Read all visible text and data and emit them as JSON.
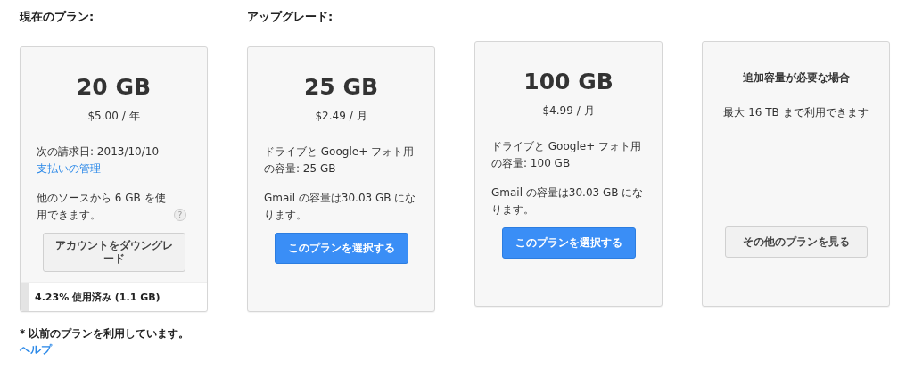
{
  "current": {
    "heading": "現在のプラン:",
    "card": {
      "size": "20 GB",
      "price": "$5.00 / 年",
      "billing": "次の請求日: 2013/10/10",
      "manage_link": "支払いの管理",
      "other_sources": "他のソースから 6 GB を使用できます。",
      "help_icon": "?",
      "downgrade_button": "アカウントをダウングレード",
      "usage": {
        "label": "4.23% 使用済み (1.1 GB)",
        "level": 0.0423
      }
    },
    "note": "* 以前のプランを利用しています。",
    "note_link": "ヘルプ"
  },
  "upgrade": {
    "heading": "アップグレード:",
    "plans": [
      {
        "kind": "plan",
        "size": "25 GB",
        "price": "$2.49 / 月",
        "drive_text": "ドライブと Google+ フォト用の容量: 25 GB",
        "gmail_text": "Gmail の容量は30.03 GB になります。",
        "button": "このプランを選択する"
      },
      {
        "kind": "plan",
        "size": "100 GB",
        "price": "$4.99 / 月",
        "drive_text": "ドライブと Google+ フォト用の容量: 100 GB",
        "gmail_text": "Gmail の容量は30.03 GB になります。",
        "button": "このプランを選択する"
      },
      {
        "kind": "more",
        "title": "追加容量が必要な場合",
        "subtitle": "最大 16 TB まで利用できます",
        "button": "その他のプランを見る"
      }
    ]
  }
}
